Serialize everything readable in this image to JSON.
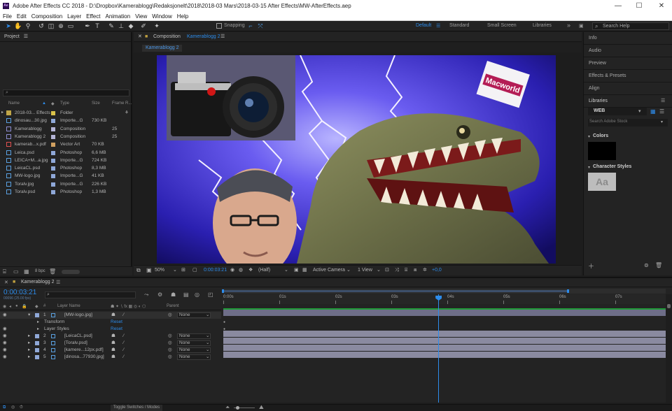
{
  "window": {
    "title": "Adobe After Effects CC 2018 - D:\\Dropbox\\Kamerablogg\\Redaksjonelt\\2018\\2018-03 Mars\\2018-03-15 After Effects\\MW-AfterEffects.aep",
    "app_icon_label": "Ae",
    "controls": {
      "minimize": "—",
      "maximize": "☐",
      "close": "✕"
    }
  },
  "menu": [
    "File",
    "Edit",
    "Composition",
    "Layer",
    "Effect",
    "Animation",
    "View",
    "Window",
    "Help"
  ],
  "toolbar": {
    "snapping_label": "Snapping",
    "workspaces": [
      "Default",
      "Standard",
      "Small Screen",
      "Libraries"
    ],
    "active_workspace": "Default",
    "more_label": "»",
    "search_placeholder": "Search Help"
  },
  "project": {
    "panel_title": "Project",
    "search_glyph": "⌕",
    "columns": {
      "name": "Name",
      "type": "Type",
      "size": "Size",
      "frame_rate": "Frame R..."
    },
    "items": [
      {
        "name": "2018-03... Effects",
        "type": "Folder",
        "size": "",
        "rate": "",
        "swatch": "#d9c24a",
        "icon": "folder-icon"
      },
      {
        "name": "dinosau...30.jpg",
        "type": "Importe...G",
        "size": "730 KB",
        "rate": "",
        "swatch": "#8fa8d8",
        "icon": "image-file-icon"
      },
      {
        "name": "Kamerablogg",
        "type": "Composition",
        "size": "",
        "rate": "25",
        "swatch": "#b5b5d8",
        "icon": "composition-icon"
      },
      {
        "name": "Kamerablogg 2",
        "type": "Composition",
        "size": "",
        "rate": "25",
        "swatch": "#b5b5d8",
        "icon": "composition-icon"
      },
      {
        "name": "kamerab...x.pdf",
        "type": "Vector Art",
        "size": "70 KB",
        "rate": "",
        "swatch": "#d0a060",
        "icon": "pdf-file-icon"
      },
      {
        "name": "Leica.psd",
        "type": "Photoshop",
        "size": "6,6 MB",
        "rate": "",
        "swatch": "#8fa8d8",
        "icon": "psd-file-icon"
      },
      {
        "name": "LEICA+M...a.jpg",
        "type": "Importe...G",
        "size": "724 KB",
        "rate": "",
        "swatch": "#8fa8d8",
        "icon": "image-file-icon"
      },
      {
        "name": "LeicaCL.psd",
        "type": "Photoshop",
        "size": "8,3 MB",
        "rate": "",
        "swatch": "#8fa8d8",
        "icon": "psd-file-icon"
      },
      {
        "name": "MW-logo.jpg",
        "type": "Importe...G",
        "size": "41 KB",
        "rate": "",
        "swatch": "#8fa8d8",
        "icon": "image-file-icon"
      },
      {
        "name": "Toralv.jpg",
        "type": "Importe...G",
        "size": "226 KB",
        "rate": "",
        "swatch": "#8fa8d8",
        "icon": "image-file-icon"
      },
      {
        "name": "Toralv.psd",
        "type": "Photoshop",
        "size": "1,3 MB",
        "rate": "",
        "swatch": "#8fa8d8",
        "icon": "psd-file-icon"
      }
    ],
    "bpc_label": "8 bpc"
  },
  "composition": {
    "panel_label": "Composition",
    "comp_name": "Kamerablogg 2",
    "sub_tab": "Kamerablogg 2",
    "macworld_text": "Macworld",
    "footer": {
      "zoom": "50%",
      "timecode": "0:00:03:21",
      "resolution": "(Half)",
      "camera": "Active Camera",
      "views": "1 View",
      "exposure": "+0,0"
    }
  },
  "right_panel": {
    "items": [
      "Info",
      "Audio",
      "Preview",
      "Effects & Presets",
      "Align",
      "Libraries"
    ],
    "library_select": "WEB",
    "library_search_placeholder": "Search Adobe Stock",
    "colors_label": "Colors",
    "character_styles_label": "Character Styles",
    "char_sample": "Aa"
  },
  "timeline": {
    "tab_label": "Kamerablogg 2",
    "current_time": "0:00:03:21",
    "frame_info": "00096 (25.00 fps)",
    "search_glyph": "⌕",
    "columns": {
      "layer_name": "Layer Name",
      "parent": "Parent"
    },
    "layers": [
      {
        "num": "1",
        "name": "[MW-logo.jpg]",
        "parent": "None",
        "expanded": true
      },
      {
        "num": "2",
        "name": "[LeicaCL.psd]",
        "parent": "None",
        "expanded": false
      },
      {
        "num": "3",
        "name": "[Toralv.psd]",
        "parent": "None",
        "expanded": false
      },
      {
        "num": "4",
        "name": "[kamere...12px.pdf]",
        "parent": "None",
        "expanded": false
      },
      {
        "num": "5",
        "name": "[dinosa...77930.jpg]",
        "parent": "None",
        "expanded": false
      }
    ],
    "sub_rows": [
      {
        "label": "Transform",
        "action": "Reset"
      },
      {
        "label": "Layer Styles",
        "action": "Reset"
      }
    ],
    "ruler_labels": [
      "0:00s",
      "01s",
      "02s",
      "03s",
      "04s",
      "05s",
      "06s",
      "07s"
    ],
    "playhead_seconds": 3.84,
    "duration_seconds": 7.9
  },
  "status": {
    "toggle_label": "Toggle Switches / Modes"
  },
  "colors": {
    "accent": "#2d8ceb",
    "panel_bg": "#232323",
    "layer_bar": "#8a8aa0",
    "work_area": "#1f9b38"
  }
}
